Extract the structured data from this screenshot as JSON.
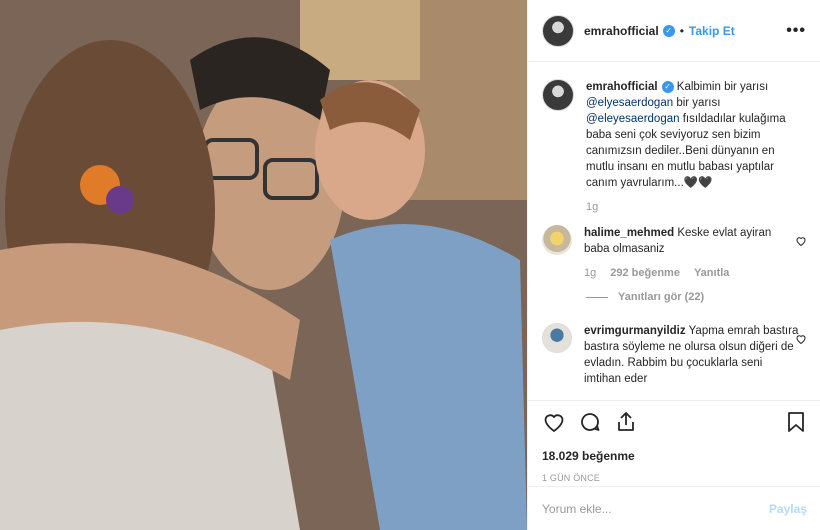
{
  "post": {
    "photo_alt": "photo"
  },
  "header": {
    "username": "emrahofficial",
    "separator": "•",
    "follow_label": "Takip Et",
    "more_label": "•••"
  },
  "caption": {
    "username": "emrahofficial",
    "text_1": " Kalbimin bir yarısı ",
    "mention_1": "@elyesaerdogan",
    "text_2": " bir yarısı ",
    "mention_2": "@eleyesaerdogan",
    "text_3": " fısıldadılar kulağıma baba seni çok seviyoruz sen bizim canımızsın dediler..Beni dünyanın en mutlu insanı en mutlu babası yaptılar canım yavrularım...🖤🖤",
    "time": "1g"
  },
  "comments": [
    {
      "username": "halime_mehmed",
      "text": " Keske evlat ayiran baba olmasaniz",
      "time": "1g",
      "likes": "292 beğenme",
      "reply": "Yanıtla",
      "view_replies": "Yanıtları gör (22)"
    },
    {
      "username": "evrimgurmanyildiz",
      "text": " Yapma emrah bastıra bastıra söyleme ne olursa olsun diğeri de evladın. Rabbim bu çocuklarla seni imtihan eder"
    }
  ],
  "actions": {
    "likes": "18.029 beğenme",
    "date": "1 GÜN ÖNCE"
  },
  "add_comment": {
    "placeholder": "Yorum ekle...",
    "submit_label": "Paylaş"
  },
  "colors": {
    "accent": "#3897f0",
    "verified": "#3897f0",
    "muted": "#999999",
    "submit_disabled": "#b3dbff"
  },
  "icons": {
    "heart": "heart-icon",
    "comment": "comment-icon",
    "share": "share-icon",
    "bookmark": "bookmark-icon"
  }
}
